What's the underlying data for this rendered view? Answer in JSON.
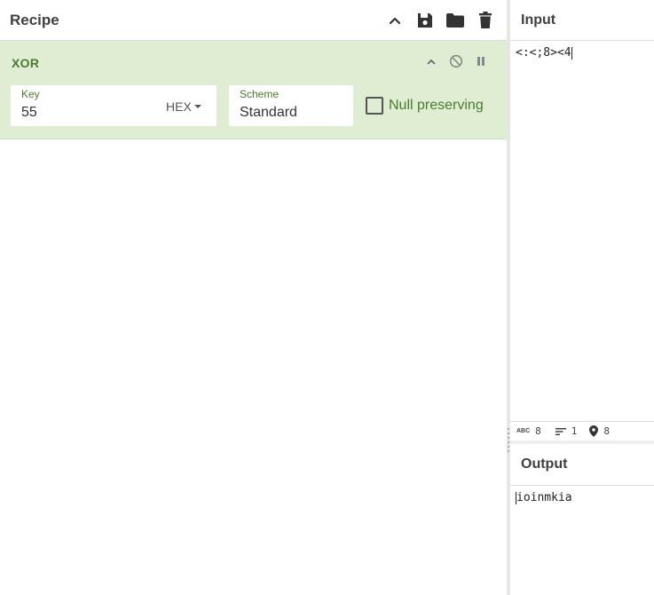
{
  "recipe": {
    "title": "Recipe",
    "header_icons": [
      "chevron-up-icon",
      "save-icon",
      "folder-icon",
      "trash-icon"
    ]
  },
  "operation": {
    "name": "XOR",
    "controls": [
      "chevron-up-icon",
      "disable-icon",
      "pause-icon"
    ],
    "key": {
      "label": "Key",
      "value": "55",
      "type": "HEX"
    },
    "scheme": {
      "label": "Scheme",
      "value": "Standard"
    },
    "null_preserving": {
      "label": "Null preserving",
      "checked": false
    },
    "colors": {
      "background": "#dfeed3",
      "accent": "#4c7a2e"
    }
  },
  "input": {
    "title": "Input",
    "text": "<:<;8><4"
  },
  "status": {
    "length_label": "ABC",
    "length": "8",
    "lines": "1",
    "position": "8"
  },
  "output": {
    "title": "Output",
    "text": "ioinmkia"
  }
}
